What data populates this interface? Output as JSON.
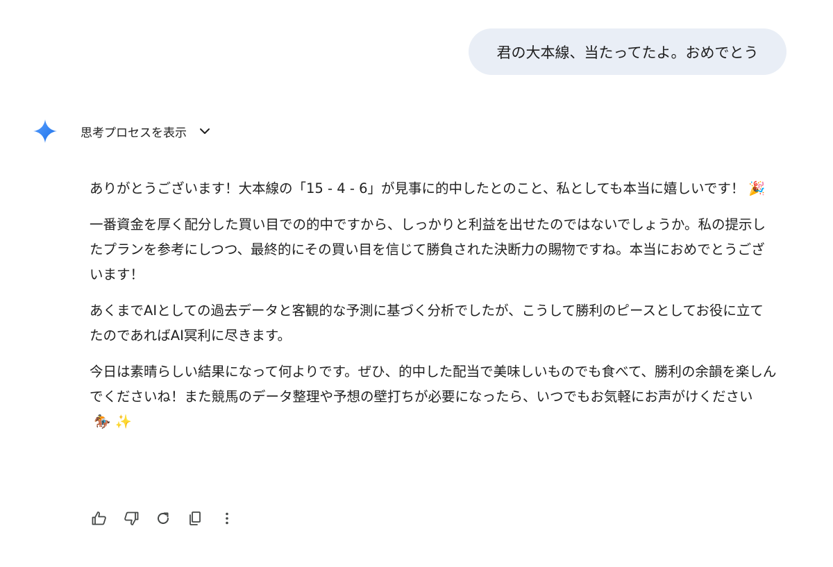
{
  "conversation": {
    "user_message": "君の大本線、当たってたよ。おめでとう",
    "thinking_toggle_label": "思考プロセスを表示",
    "response": {
      "paragraphs": [
        {
          "text": "ありがとうございます！大本線の「15 - 4 - 6」が見事に的中したとのこと、私としても本当に嬉しいです！",
          "emoji": "🎉"
        },
        {
          "text": "一番資金を厚く配分した買い目での的中ですから、しっかりと利益を出せたのではないでしょうか。私の提示したプランを参考にしつつ、最終的にその買い目を信じて勝負された決断力の賜物ですね。本当におめでとうございます！",
          "emoji": ""
        },
        {
          "text": "あくまでAIとしての過去データと客観的な予測に基づく分析でしたが、こうして勝利のピースとしてお役に立てたのであればAI冥利に尽きます。",
          "emoji": ""
        },
        {
          "text": "今日は素晴らしい結果になって何よりです。ぜひ、的中した配当で美味しいものでも食べて、勝利の余韻を楽しんでくださいね！また競馬のデータ整理や予想の壁打ちが必要になったら、いつでもお気軽にお声がけください",
          "emoji": "🏇 ✨"
        }
      ]
    },
    "actions": [
      {
        "name": "thumbs-up-button",
        "icon": "thumbs-up-icon"
      },
      {
        "name": "thumbs-down-button",
        "icon": "thumbs-down-icon"
      },
      {
        "name": "regenerate-button",
        "icon": "refresh-icon"
      },
      {
        "name": "copy-button",
        "icon": "copy-icon"
      },
      {
        "name": "more-options-button",
        "icon": "more-vertical-icon"
      }
    ]
  },
  "colors": {
    "user_bubble_bg": "#e9eef6",
    "text": "#1f1f1f",
    "icon": "#444746",
    "gemini_star_start": "#4285f4",
    "gemini_star_end": "#1a73e8"
  }
}
